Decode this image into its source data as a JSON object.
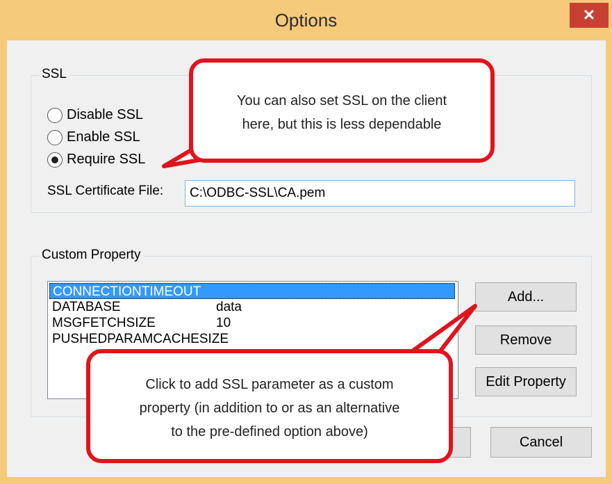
{
  "window": {
    "title": "Options",
    "close_glyph": "✕"
  },
  "ssl": {
    "legend": "SSL",
    "options": [
      {
        "label": "Disable SSL",
        "selected": false
      },
      {
        "label": "Enable SSL",
        "selected": false
      },
      {
        "label": "Require SSL",
        "selected": true
      }
    ],
    "cert_label": "SSL Certificate File:",
    "cert_value": "C:\\ODBC-SSL\\CA.pem"
  },
  "custom": {
    "legend": "Custom Property",
    "rows": [
      {
        "key": "CONNECTIONTIMEOUT",
        "value": ""
      },
      {
        "key": "DATABASE",
        "value": "data"
      },
      {
        "key": "MSGFETCHSIZE",
        "value": "10"
      },
      {
        "key": "PUSHEDPARAMCACHESIZE",
        "value": ""
      }
    ],
    "add_label": "Add...",
    "remove_label": "Remove",
    "edit_label": "Edit Property"
  },
  "footer": {
    "cancel_label": "Cancel"
  },
  "callouts": {
    "ssl_note_line1": "You can also set SSL on the client",
    "ssl_note_line2": "here, but this is less dependable",
    "add_note_line1": "Click to add SSL parameter as a custom",
    "add_note_line2": "property (in addition to or as an alternative",
    "add_note_line3": "to the pre-defined  option above)"
  },
  "colors": {
    "callout_border": "#e0141e",
    "selection": "#3399ff",
    "close": "#c84031",
    "frame": "#f5ca7a"
  }
}
